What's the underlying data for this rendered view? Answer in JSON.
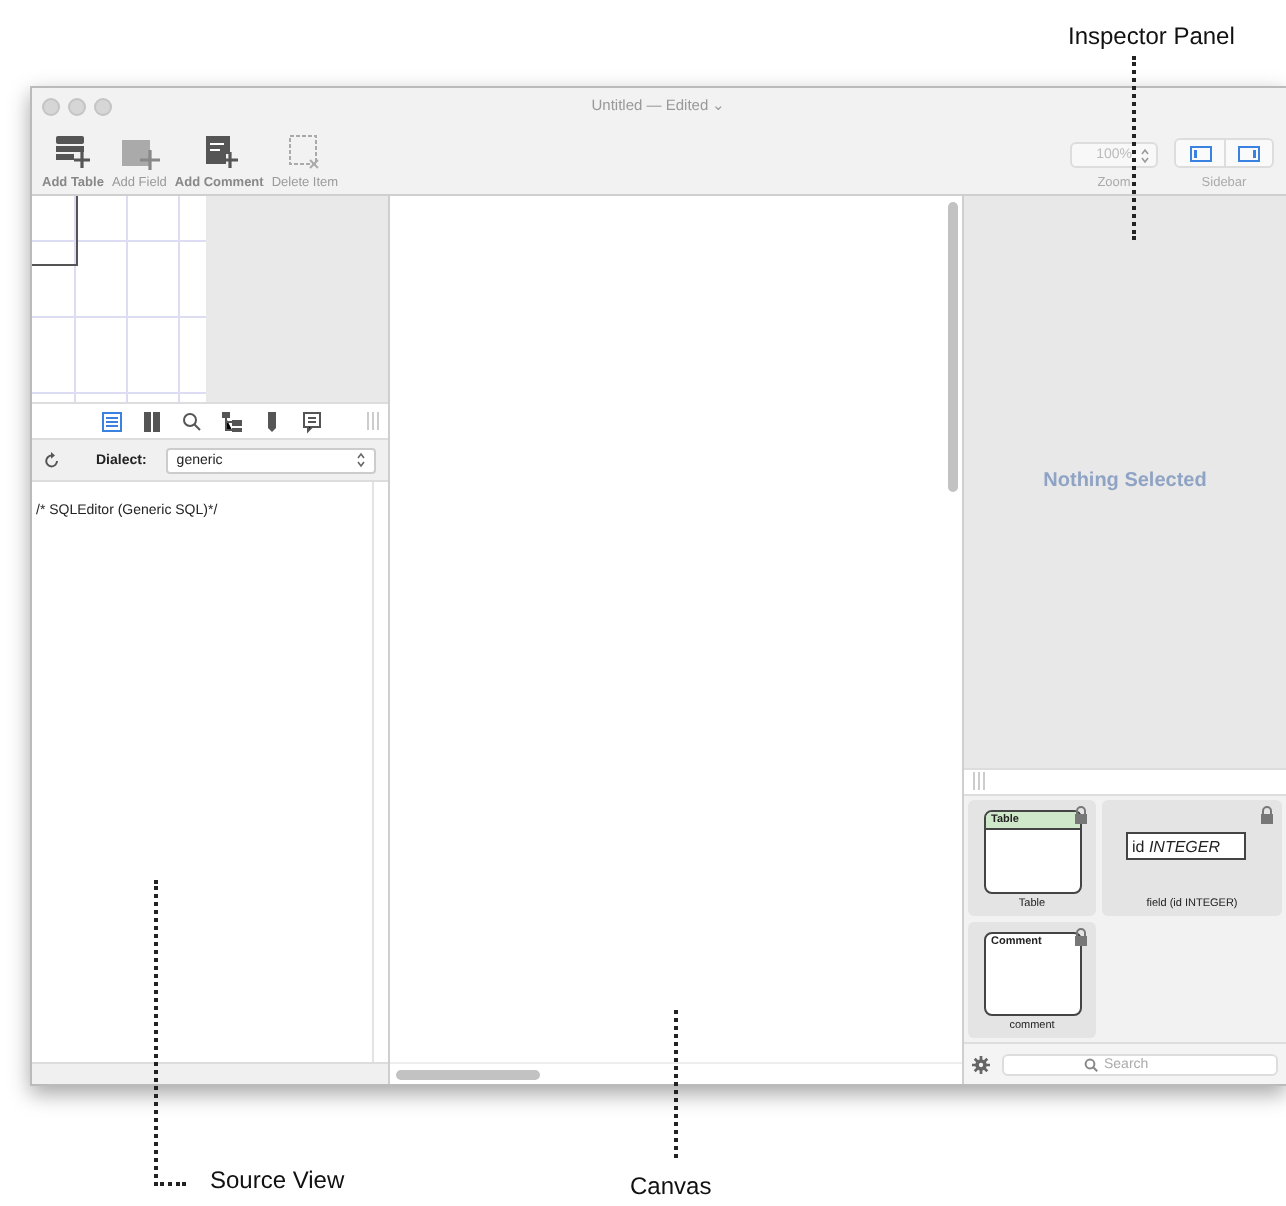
{
  "callouts": [
    {
      "kind": "inspector",
      "label": "Inspector Panel"
    },
    {
      "kind": "source",
      "label": "Source View"
    },
    {
      "kind": "canvas",
      "label": "Canvas"
    }
  ],
  "window": {
    "title": "Untitled",
    "status": "— Edited",
    "menu_glyph": "⌄"
  },
  "toolbar": {
    "items": [
      {
        "kind": "table",
        "label": "Add Table",
        "disabled": false
      },
      {
        "kind": "field",
        "label": "Add Field",
        "disabled": true
      },
      {
        "kind": "comment",
        "label": "Add Comment",
        "disabled": false
      },
      {
        "kind": "delete",
        "label": "Delete Item",
        "disabled": true
      }
    ],
    "zoom": {
      "value": "100%",
      "label": "Zoom"
    },
    "sidebar": {
      "label": "Sidebar",
      "buttons": [
        {
          "kind": "left",
          "on": true
        },
        {
          "kind": "right",
          "on": true
        }
      ]
    }
  },
  "source_panel": {
    "tabs": [
      {
        "kind": "list",
        "selected": true
      },
      {
        "kind": "book",
        "selected": false
      },
      {
        "kind": "search",
        "selected": false
      },
      {
        "kind": "tree",
        "selected": false
      },
      {
        "kind": "tag",
        "selected": false
      },
      {
        "kind": "note",
        "selected": false
      }
    ],
    "dialect_label": "Dialect:",
    "dialect": "generic",
    "code": "/* SQLEditor (Generic SQL)*/"
  },
  "inspector": {
    "message": "Nothing Selected"
  },
  "library": {
    "items": [
      {
        "kind": "table",
        "header": "Table",
        "label": "Table"
      },
      {
        "kind": "field",
        "header": "id *INTEGER*",
        "label": "field (id INTEGER)"
      },
      {
        "kind": "comment",
        "header": "Comment",
        "label": "comment"
      }
    ],
    "search_placeholder": "Search"
  }
}
